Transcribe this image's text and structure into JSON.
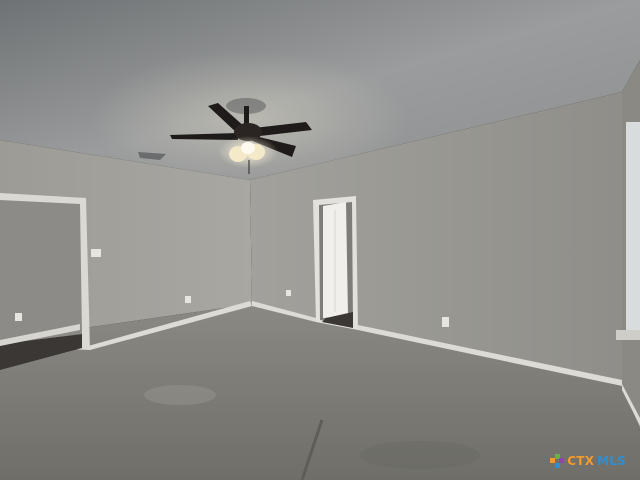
{
  "scene": {
    "description_tag": "empty-room-interior",
    "colors": {
      "ceiling": "#8a8c8d",
      "left_wall": "#a5a39e",
      "back_wall": "#9a9994",
      "floor": "#7d7c77",
      "trim": "#d9d8d3",
      "fan_blade": "#1f1b1a",
      "light_glow": "#f4e9c8",
      "doorway_dark": "#3a3734"
    }
  },
  "watermark": {
    "logo_icon": "ctx-mls-logo-icon",
    "brand_ctx": "CTX",
    "brand_mls": "MLS",
    "ctx_color": "#f29a2e",
    "mls_color": "#2f8fd0"
  }
}
